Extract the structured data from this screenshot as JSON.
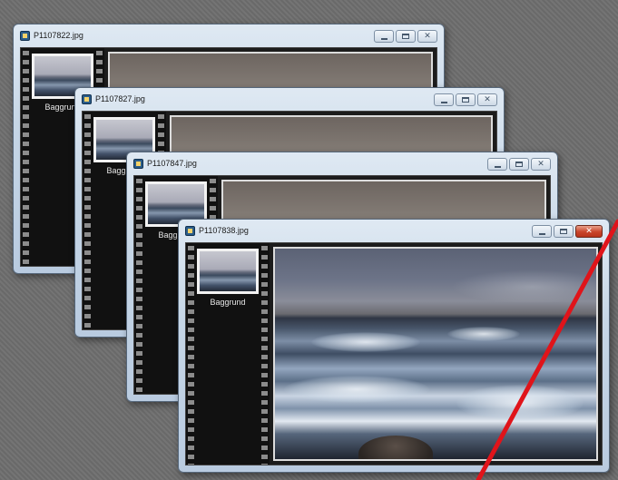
{
  "windows": [
    {
      "title": "P1107822.jpg",
      "thumb_label": "Baggrund",
      "active": false
    },
    {
      "title": "P1107827.jpg",
      "thumb_label": "Baggrund",
      "active": false
    },
    {
      "title": "P1107847.jpg",
      "thumb_label": "Baggrund",
      "active": false
    },
    {
      "title": "P1107838.jpg",
      "thumb_label": "Baggrund",
      "active": true
    }
  ],
  "icons": {
    "window_icon": "image-file-icon",
    "minimize": "minimize-icon",
    "maximize": "maximize-icon",
    "close": "close-icon"
  },
  "colors": {
    "annotation_line": "#e0141a",
    "close_button_active": "#c9442a",
    "titlebar": "#c6d6e6",
    "filmstrip": "#111111"
  }
}
